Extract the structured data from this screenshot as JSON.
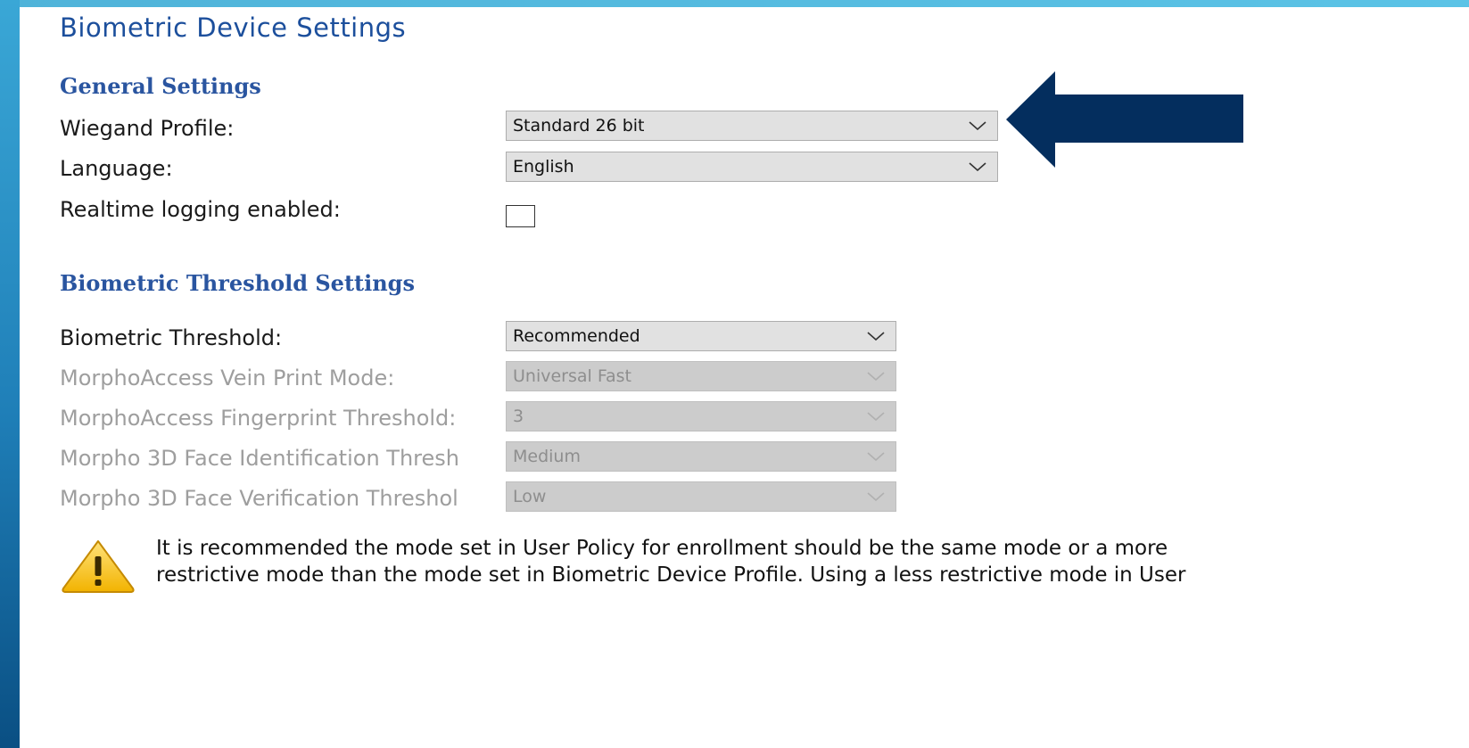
{
  "window": {
    "title": "Biometric Device Settings"
  },
  "general": {
    "heading": "General Settings",
    "wiegand_label": "Wiegand Profile:",
    "wiegand_value": "Standard 26 bit",
    "language_label": "Language:",
    "language_value": "English",
    "realtime_label": "Realtime logging enabled:",
    "realtime_checked": false
  },
  "threshold": {
    "heading": "Biometric Threshold Settings",
    "biometric_label": "Biometric Threshold:",
    "biometric_value": "Recommended",
    "vein_label": "MorphoAccess Vein Print Mode:",
    "vein_value": "Universal Fast",
    "fingerprint_label": "MorphoAccess Fingerprint Threshold:",
    "fingerprint_value": "3",
    "face_id_label": "Morpho 3D Face Identification Thresh",
    "face_id_value": "Medium",
    "face_verif_label": "Morpho 3D Face Verification Threshol",
    "face_verif_value": "Low"
  },
  "warning": {
    "icon": "warning-icon",
    "line1": "It is recommended the mode set in User Policy for enrollment should be the same mode or a more",
    "line2": "restrictive mode than the mode set in Biometric Device Profile.  Using a less restrictive mode in User"
  },
  "annotation": {
    "icon": "arrow-left-icon",
    "color": "#042e5e"
  }
}
